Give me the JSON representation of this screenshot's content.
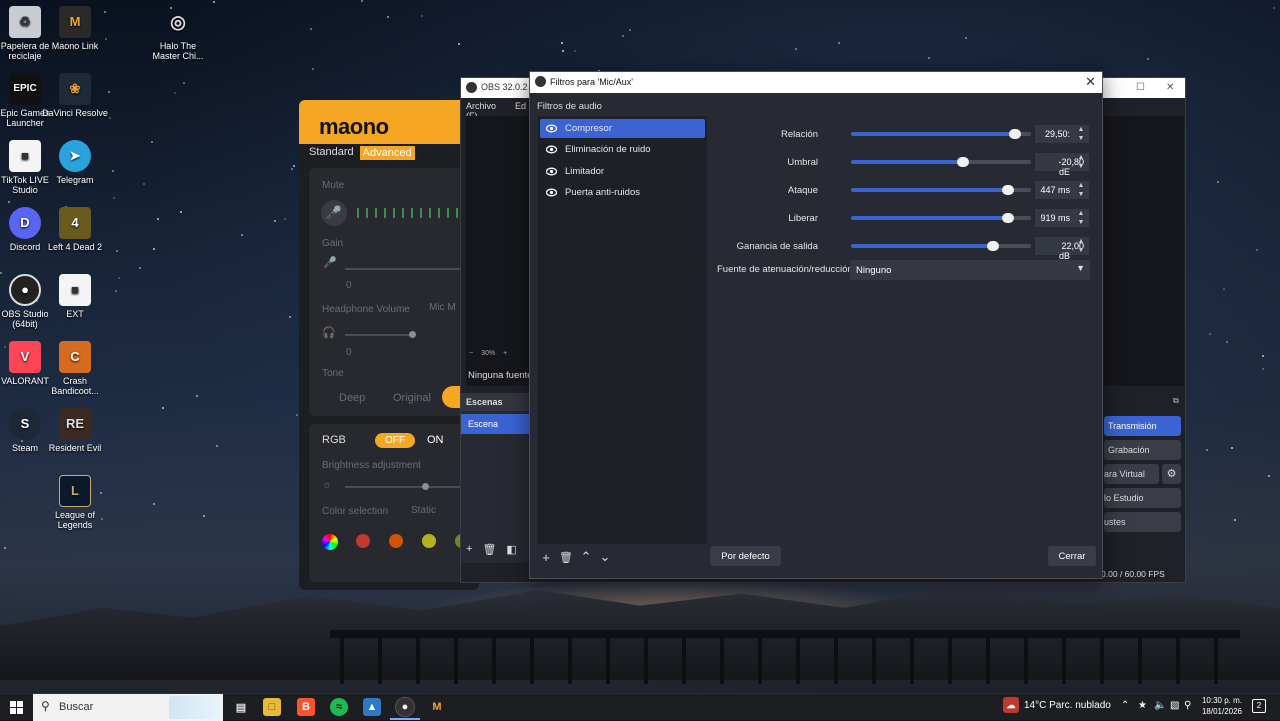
{
  "desktop": {
    "icons": [
      {
        "label": "Papelera de reciclaje",
        "icon": "recycle-bin-icon"
      },
      {
        "label": "Maono Link",
        "icon": "maono-icon"
      },
      {
        "label": "Halo The Master Chi...",
        "icon": "halo-icon"
      },
      {
        "label": "Epic Games Launcher",
        "icon": "epic-icon"
      },
      {
        "label": "DaVinci Resolve",
        "icon": "davinci-icon"
      },
      {
        "label": "TikTok LIVE Studio",
        "icon": "file-icon"
      },
      {
        "label": "Telegram",
        "icon": "telegram-icon"
      },
      {
        "label": "Discord",
        "icon": "discord-icon"
      },
      {
        "label": "Left 4 Dead 2",
        "icon": "l4d2-icon"
      },
      {
        "label": "OBS Studio (64bit)",
        "icon": "obs-icon"
      },
      {
        "label": "EXT",
        "icon": "file-icon"
      },
      {
        "label": "VALORANT",
        "icon": "valorant-icon"
      },
      {
        "label": "Crash Bandicoot...",
        "icon": "crash-icon"
      },
      {
        "label": "Steam",
        "icon": "steam-icon"
      },
      {
        "label": "Resident Evil",
        "icon": "re-icon"
      },
      {
        "label": "League of Legends",
        "icon": "lol-icon"
      }
    ]
  },
  "maono": {
    "logo": "maono",
    "tab_standard": "Standard",
    "tab_advanced": "Advanced",
    "mute": "Mute",
    "gain": "Gain",
    "gain_value": "0",
    "headphone_volume": "Headphone Volume",
    "mic_monitor": "Mic M",
    "hp_value": "0",
    "tone": "Tone",
    "tone_deep": "Deep",
    "tone_original": "Original",
    "rgb": "RGB",
    "rgb_off": "OFF",
    "rgb_on": "ON",
    "brightness": "Brightness adjustment",
    "color_selection": "Color selection",
    "static": "Static",
    "colors": [
      "#c0392b",
      "#d35400",
      "#b7b21a",
      "#6e8b1f"
    ]
  },
  "obs": {
    "title": "OBS 32.0.2 - P",
    "menu_file": "Archivo (F)",
    "menu_edit": "Ed",
    "zoom": "30%",
    "no_source": "Ninguna fuente",
    "scenes_header": "Escenas",
    "scene_item": "Escena",
    "btn_stream": "Transmisión",
    "btn_record": "Grabación",
    "btn_virtual": "ara Virtual",
    "btn_studio": "lo Estudio",
    "btn_settings": "ustes",
    "fps": "0.00 / 60.00 FPS"
  },
  "dialog": {
    "title": "Filtros para 'Mic/Aux'",
    "section": "Filtros de audio",
    "filters": [
      {
        "name": "Compresor",
        "selected": true
      },
      {
        "name": "Eliminación de ruido",
        "selected": false
      },
      {
        "name": "Limitador",
        "selected": false
      },
      {
        "name": "Puerta anti-ruidos",
        "selected": false
      }
    ],
    "params": [
      {
        "label": "Relación",
        "value": "29,50:",
        "level": 0.91
      },
      {
        "label": "Umbral",
        "value": "-20,80 dE",
        "level": 0.62
      },
      {
        "label": "Ataque",
        "value": "447 ms",
        "level": 0.87
      },
      {
        "label": "Liberar",
        "value": "919 ms",
        "level": 0.87
      },
      {
        "label": "Ganancia de salida",
        "value": "22,00 dB",
        "level": 0.79
      }
    ],
    "ducking_label": "Fuente de atenuación/reducción",
    "ducking_value": "Ninguno",
    "btn_defaults": "Por defecto",
    "btn_close": "Cerrar"
  },
  "taskbar": {
    "search_placeholder": "Buscar",
    "weather": "14°C  Parc. nublado",
    "time": "10:30 p. m.",
    "date": "18/01/2026",
    "notifications": "2"
  },
  "colors": {
    "accent": "#3b63d1",
    "maono_orange": "#f5a623"
  }
}
